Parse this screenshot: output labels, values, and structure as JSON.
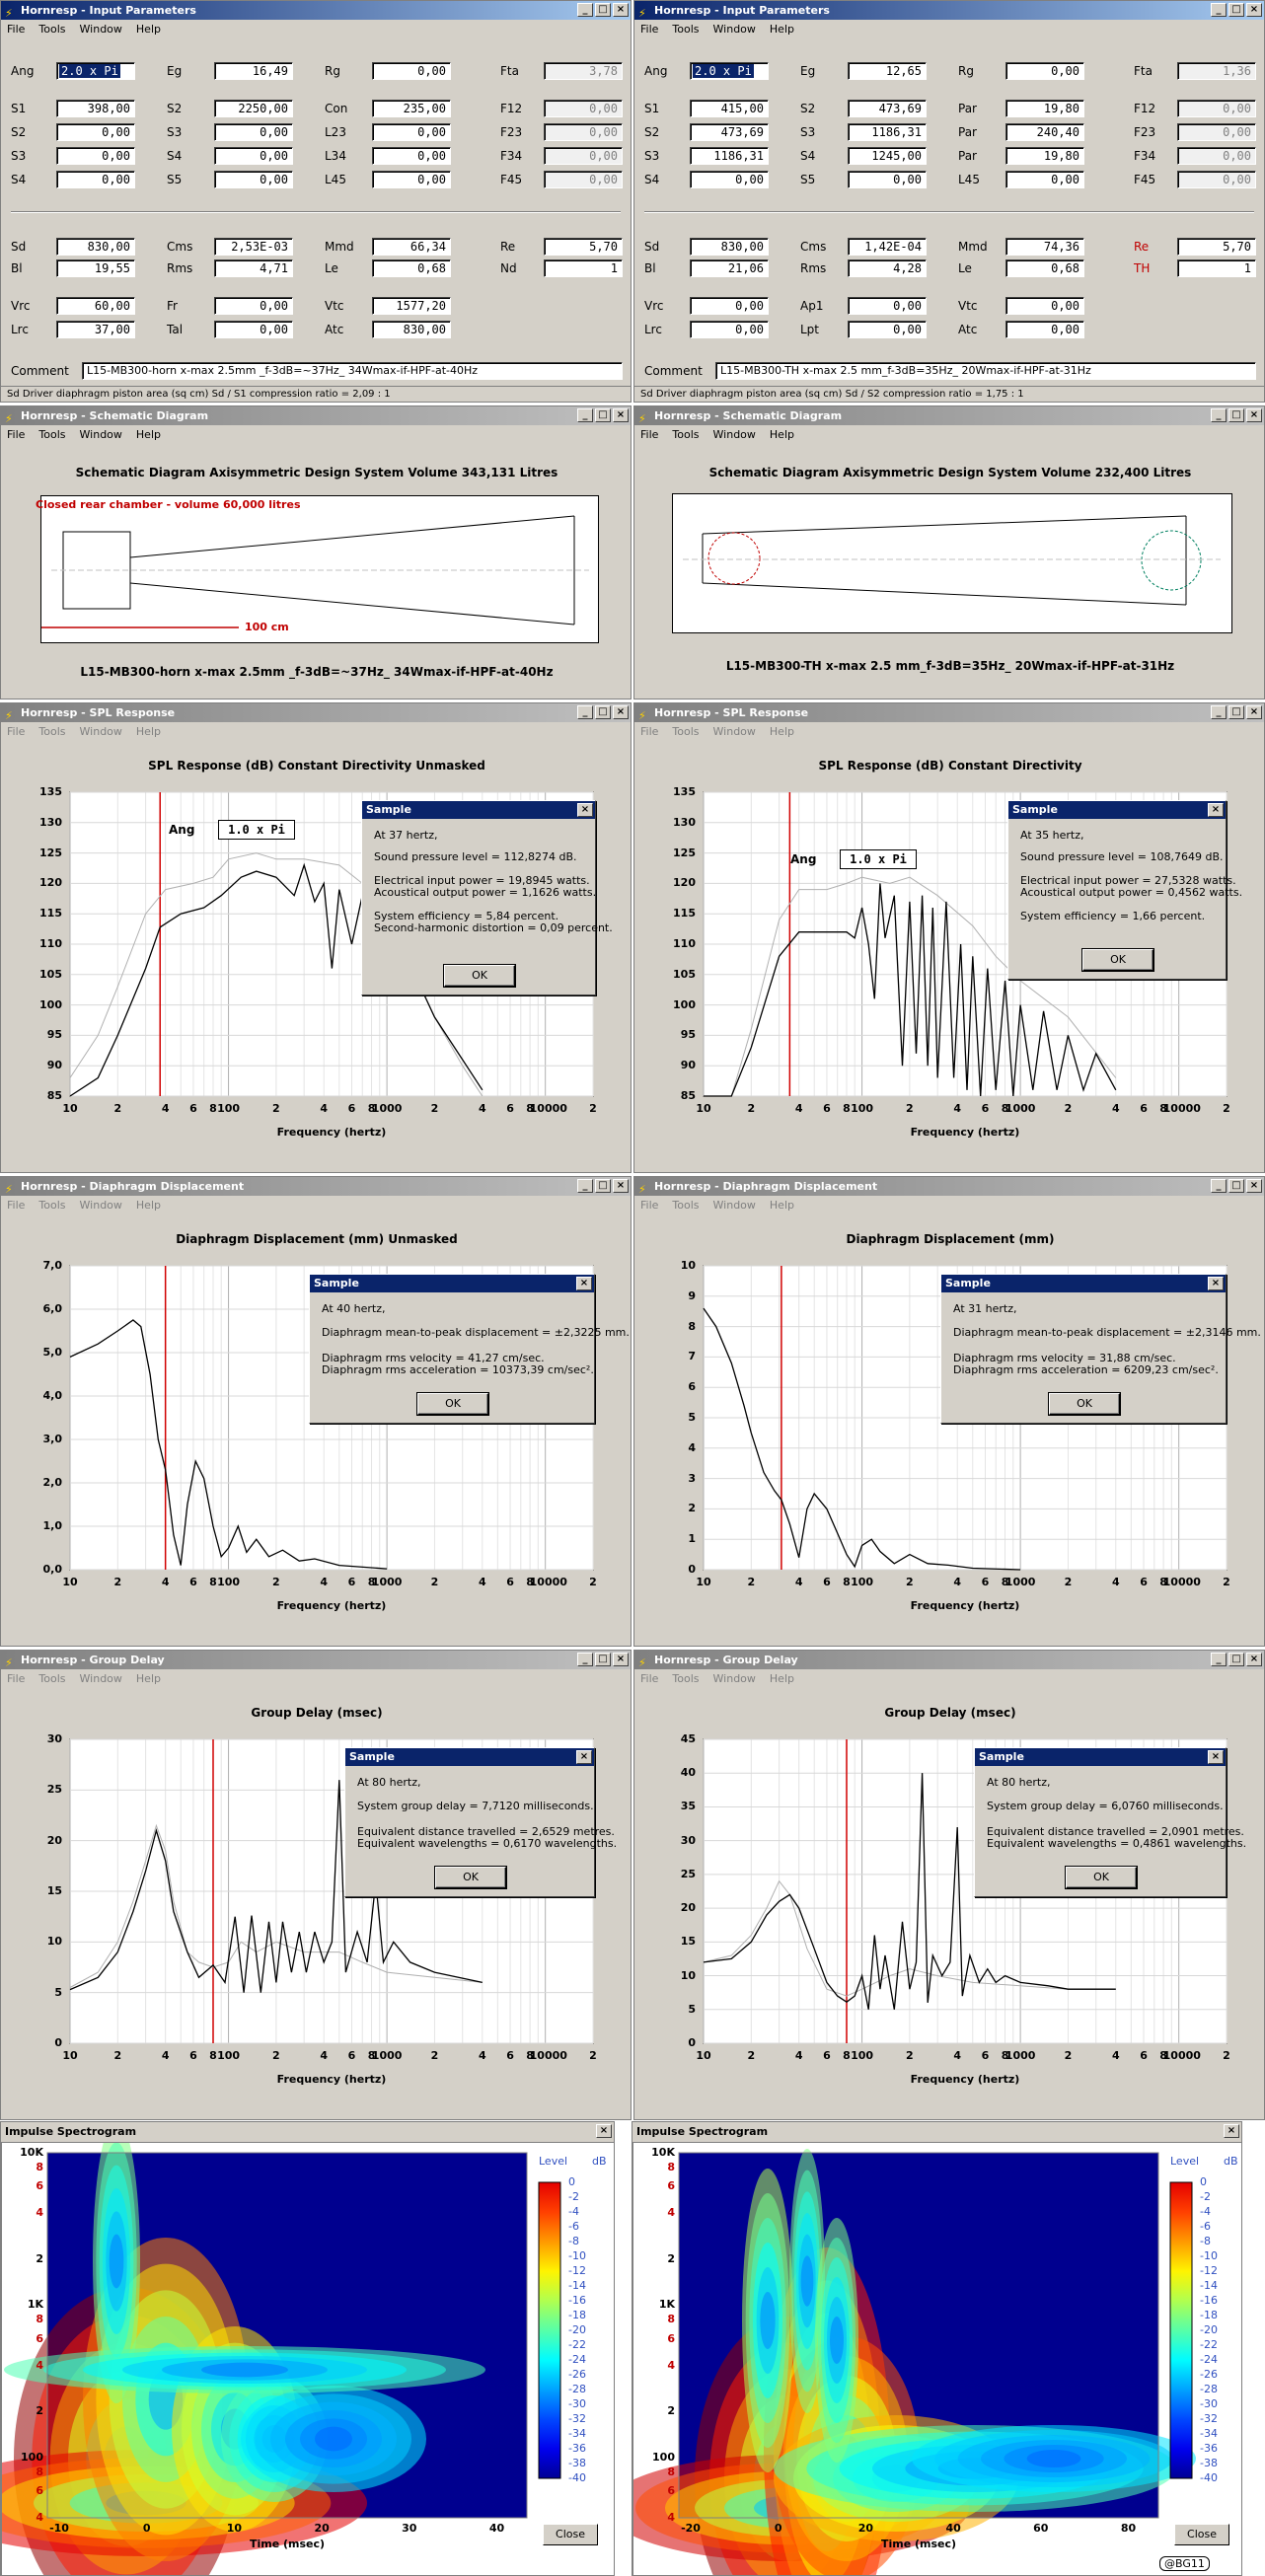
{
  "menus_active": [
    "File",
    "Tools",
    "Window",
    "Help"
  ],
  "menus_inactive": [
    "File",
    "Tools",
    "Window",
    "Help"
  ],
  "input_left": {
    "title": "Hornresp - Input Parameters",
    "rows": [
      [
        {
          "l": "Ang",
          "v": "2.0 x Pi",
          "sel": true
        },
        {
          "l": "Eg",
          "v": "16,49"
        },
        {
          "l": "Rg",
          "v": "0,00"
        },
        {
          "l": "Fta",
          "v": "3,78",
          "dis": true
        }
      ],
      [
        {
          "l": "S1",
          "v": "398,00"
        },
        {
          "l": "S2",
          "v": "2250,00"
        },
        {
          "l": "Con",
          "v": "235,00"
        },
        {
          "l": "F12",
          "v": "0,00",
          "dis": true
        }
      ],
      [
        {
          "l": "S2",
          "v": "0,00"
        },
        {
          "l": "S3",
          "v": "0,00"
        },
        {
          "l": "L23",
          "v": "0,00"
        },
        {
          "l": "F23",
          "v": "0,00",
          "dis": true
        }
      ],
      [
        {
          "l": "S3",
          "v": "0,00"
        },
        {
          "l": "S4",
          "v": "0,00"
        },
        {
          "l": "L34",
          "v": "0,00"
        },
        {
          "l": "F34",
          "v": "0,00",
          "dis": true
        }
      ],
      [
        {
          "l": "S4",
          "v": "0,00"
        },
        {
          "l": "S5",
          "v": "0,00"
        },
        {
          "l": "L45",
          "v": "0,00"
        },
        {
          "l": "F45",
          "v": "0,00",
          "dis": true
        }
      ]
    ],
    "rows2": [
      [
        {
          "l": "Sd",
          "v": "830,00"
        },
        {
          "l": "Cms",
          "v": "2,53E-03"
        },
        {
          "l": "Mmd",
          "v": "66,34"
        },
        {
          "l": "Re",
          "v": "5,70"
        }
      ],
      [
        {
          "l": "Bl",
          "v": "19,55"
        },
        {
          "l": "Rms",
          "v": "4,71"
        },
        {
          "l": "Le",
          "v": "0,68"
        },
        {
          "l": "Nd",
          "v": "1"
        }
      ]
    ],
    "rows3": [
      [
        {
          "l": "Vrc",
          "v": "60,00"
        },
        {
          "l": "Fr",
          "v": "0,00"
        },
        {
          "l": "Vtc",
          "v": "1577,20"
        }
      ],
      [
        {
          "l": "Lrc",
          "v": "37,00"
        },
        {
          "l": "Tal",
          "v": "0,00"
        },
        {
          "l": "Atc",
          "v": "830,00"
        }
      ]
    ],
    "comment_label": "Comment",
    "comment": "L15-MB300-horn x-max 2.5mm _f-3dB=~37Hz_ 34Wmax-if-HPF-at-40Hz",
    "status": "Sd   Driver diaphragm piston area  (sq cm)   Sd / S1 compression ratio = 2,09 : 1"
  },
  "input_right": {
    "title": "Hornresp - Input Parameters",
    "rows": [
      [
        {
          "l": "Ang",
          "v": "2.0 x Pi",
          "sel": true
        },
        {
          "l": "Eg",
          "v": "12,65"
        },
        {
          "l": "Rg",
          "v": "0,00"
        },
        {
          "l": "Fta",
          "v": "1,36",
          "dis": true
        }
      ],
      [
        {
          "l": "S1",
          "v": "415,00"
        },
        {
          "l": "S2",
          "v": "473,69"
        },
        {
          "l": "Par",
          "v": "19,80"
        },
        {
          "l": "F12",
          "v": "0,00",
          "dis": true
        }
      ],
      [
        {
          "l": "S2",
          "v": "473,69"
        },
        {
          "l": "S3",
          "v": "1186,31"
        },
        {
          "l": "Par",
          "v": "240,40"
        },
        {
          "l": "F23",
          "v": "0,00",
          "dis": true
        }
      ],
      [
        {
          "l": "S3",
          "v": "1186,31"
        },
        {
          "l": "S4",
          "v": "1245,00"
        },
        {
          "l": "Par",
          "v": "19,80"
        },
        {
          "l": "F34",
          "v": "0,00",
          "dis": true
        }
      ],
      [
        {
          "l": "S4",
          "v": "0,00"
        },
        {
          "l": "S5",
          "v": "0,00"
        },
        {
          "l": "L45",
          "v": "0,00"
        },
        {
          "l": "F45",
          "v": "0,00",
          "dis": true
        }
      ]
    ],
    "rows2": [
      [
        {
          "l": "Sd",
          "v": "830,00"
        },
        {
          "l": "Cms",
          "v": "1,42E-04"
        },
        {
          "l": "Mmd",
          "v": "74,36"
        },
        {
          "l": "Re",
          "v": "5,70",
          "red": true
        }
      ],
      [
        {
          "l": "Bl",
          "v": "21,06"
        },
        {
          "l": "Rms",
          "v": "4,28"
        },
        {
          "l": "Le",
          "v": "0,68"
        },
        {
          "l": "TH",
          "v": "1",
          "red": true
        }
      ]
    ],
    "rows3": [
      [
        {
          "l": "Vrc",
          "v": "0,00"
        },
        {
          "l": "Ap1",
          "v": "0,00"
        },
        {
          "l": "Vtc",
          "v": "0,00"
        }
      ],
      [
        {
          "l": "Lrc",
          "v": "0,00"
        },
        {
          "l": "Lpt",
          "v": "0,00"
        },
        {
          "l": "Atc",
          "v": "0,00"
        }
      ]
    ],
    "comment_label": "Comment",
    "comment": "L15-MB300-TH x-max 2.5 mm_f-3dB=35Hz_ 20Wmax-if-HPF-at-31Hz",
    "status": "Sd   Driver diaphragm piston area  (sq cm)   Sd / S2 compression ratio = 1,75 : 1"
  },
  "schem_left": {
    "title": "Hornresp - Schematic Diagram",
    "header": "Schematic Diagram    Axisymmetric Design    System Volume 343,131 Litres",
    "chamber_label": "Closed rear chamber - volume 60,000 litres",
    "scale_label": "100 cm",
    "caption": "L15-MB300-horn x-max 2.5mm _f-3dB=~37Hz_ 34Wmax-if-HPF-at-40Hz"
  },
  "schem_right": {
    "title": "Hornresp - Schematic Diagram",
    "header": "Schematic Diagram    Axisymmetric Design    System Volume 232,400 Litres",
    "caption": "L15-MB300-TH x-max 2.5 mm_f-3dB=35Hz_ 20Wmax-if-HPF-at-31Hz"
  },
  "freq_ticks": [
    "10",
    "2",
    "4",
    "6",
    "8",
    "100",
    "2",
    "4",
    "6",
    "8",
    "1000",
    "2",
    "4",
    "6",
    "8",
    "10000",
    "2"
  ],
  "spl_left": {
    "title": "Hornresp - SPL Response",
    "header": "SPL Response (dB)    Constant Directivity    Unmasked",
    "xlabel": "Frequency (hertz)",
    "yticks": [
      "135",
      "130",
      "125",
      "120",
      "115",
      "110",
      "105",
      "100",
      "95",
      "90",
      "85"
    ],
    "ang_label": "Ang",
    "ang_value": "1.0 x Pi",
    "dialog": {
      "title": "Sample",
      "lines": [
        "At 37 hertz,",
        "Sound pressure level = 112,8274 dB.",
        "Electrical input power = 19,8945 watts.",
        "Acoustical output power = 1,1626 watts.",
        "System efficiency = 5,84 percent.",
        "Second-harmonic distortion = 0,09 percent."
      ],
      "ok": "OK"
    }
  },
  "spl_right": {
    "title": "Hornresp - SPL Response",
    "header": "SPL Response (dB)    Constant Directivity",
    "xlabel": "Frequency (hertz)",
    "yticks": [
      "135",
      "130",
      "125",
      "120",
      "115",
      "110",
      "105",
      "100",
      "95",
      "90",
      "85"
    ],
    "ang_label": "Ang",
    "ang_value": "1.0 x Pi",
    "dialog": {
      "title": "Sample",
      "lines": [
        "At 35 hertz,",
        "Sound pressure level = 108,7649 dB.",
        "Electrical input power = 27,5328 watts.",
        "Acoustical output power = 0,4562 watts.",
        "System efficiency = 1,66 percent."
      ],
      "ok": "OK"
    }
  },
  "disp_left": {
    "title": "Hornresp - Diaphragm Displacement",
    "header": "Diaphragm Displacement (mm)    Unmasked",
    "xlabel": "Frequency (hertz)",
    "yticks": [
      "7,0",
      "6,0",
      "5,0",
      "4,0",
      "3,0",
      "2,0",
      "1,0",
      "0,0"
    ],
    "dialog": {
      "title": "Sample",
      "lines": [
        "At 40 hertz,",
        "Diaphragm mean-to-peak displacement = ±2,3225 mm.",
        "Diaphragm rms velocity = 41,27 cm/sec.",
        "Diaphragm rms acceleration = 10373,39 cm/sec².",
        "",
        ""
      ],
      "ok": "OK"
    }
  },
  "disp_right": {
    "title": "Hornresp - Diaphragm Displacement",
    "header": "Diaphragm Displacement (mm)",
    "xlabel": "Frequency (hertz)",
    "yticks": [
      "10",
      "9",
      "8",
      "7",
      "6",
      "5",
      "4",
      "3",
      "2",
      "1",
      "0"
    ],
    "dialog": {
      "title": "Sample",
      "lines": [
        "At 31 hertz,",
        "Diaphragm mean-to-peak displacement = ±2,3146 mm.",
        "Diaphragm rms velocity = 31,88 cm/sec.",
        "Diaphragm rms acceleration = 6209,23 cm/sec².",
        "",
        ""
      ],
      "ok": "OK"
    }
  },
  "gd_left": {
    "title": "Hornresp - Group Delay",
    "header": "Group Delay (msec)",
    "xlabel": "Frequency (hertz)",
    "yticks": [
      "30",
      "25",
      "20",
      "15",
      "10",
      "5",
      "0"
    ],
    "dialog": {
      "title": "Sample",
      "lines": [
        "At 80 hertz,",
        "System group delay = 7,7120 milliseconds.",
        "Equivalent distance travelled = 2,6529 metres.",
        "Equivalent wavelengths = 0,6170 wavelengths.",
        "",
        ""
      ],
      "ok": "OK"
    }
  },
  "gd_right": {
    "title": "Hornresp - Group Delay",
    "header": "Group Delay (msec)",
    "xlabel": "Frequency (hertz)",
    "yticks": [
      "45",
      "40",
      "35",
      "30",
      "25",
      "20",
      "15",
      "10",
      "5",
      "0"
    ],
    "dialog": {
      "title": "Sample",
      "lines": [
        "At 80 hertz,",
        "System group delay = 6,0760 milliseconds.",
        "Equivalent distance travelled = 2,0901 metres.",
        "Equivalent wavelengths = 0,4861 wavelengths.",
        "",
        ""
      ],
      "ok": "OK"
    }
  },
  "spec_left": {
    "title": "Impulse Spectrogram",
    "yticks": [
      "10K",
      "8",
      "6",
      "4",
      "2",
      "1K",
      "8",
      "6",
      "4",
      "2",
      "100",
      "8",
      "6",
      "4"
    ],
    "xticks": [
      "-10",
      "0",
      "10",
      "20",
      "30",
      "40"
    ],
    "xlabel": "Time (msec)",
    "level_label": "Level",
    "db_label": "dB",
    "levels": [
      "0",
      "-2",
      "-4",
      "-6",
      "-8",
      "-10",
      "-12",
      "-14",
      "-16",
      "-18",
      "-20",
      "-22",
      "-24",
      "-26",
      "-28",
      "-30",
      "-32",
      "-34",
      "-36",
      "-38",
      "-40"
    ],
    "close": "Close"
  },
  "spec_right": {
    "title": "Impulse Spectrogram",
    "yticks": [
      "10K",
      "8",
      "6",
      "4",
      "2",
      "1K",
      "8",
      "6",
      "4",
      "2",
      "100",
      "8",
      "6",
      "4"
    ],
    "xticks": [
      "-20",
      "0",
      "20",
      "40",
      "60",
      "80"
    ],
    "xlabel": "Time (msec)",
    "level_label": "Level",
    "db_label": "dB",
    "levels": [
      "0",
      "-2",
      "-4",
      "-6",
      "-8",
      "-10",
      "-12",
      "-14",
      "-16",
      "-18",
      "-20",
      "-22",
      "-24",
      "-26",
      "-28",
      "-30",
      "-32",
      "-34",
      "-36",
      "-38",
      "-40"
    ],
    "close": "Close",
    "watermark": "@BG11"
  },
  "chart_data": [
    {
      "type": "line",
      "title": "SPL Response (dB)",
      "xlabel": "Frequency (hertz)",
      "x": [
        10,
        20,
        30,
        37,
        50,
        100,
        200,
        300,
        400,
        500,
        1000,
        2000,
        4000
      ],
      "series": [
        {
          "values": [
            85,
            95,
            108,
            112.8,
            117,
            122,
            121,
            117,
            115,
            112,
            100,
            90,
            85
          ]
        }
      ],
      "ylim": [
        85,
        135
      ],
      "xscale": "log"
    },
    {
      "type": "line",
      "title": "SPL Response (dB)",
      "xlabel": "Frequency (hertz)",
      "x": [
        10,
        20,
        35,
        50,
        100,
        150,
        200,
        500,
        1000,
        2000,
        4000
      ],
      "series": [
        {
          "values": [
            72,
            90,
            108.8,
            112,
            112,
            120,
            117,
            105,
            100,
            92,
            85
          ]
        }
      ],
      "ylim": [
        85,
        135
      ],
      "xscale": "log"
    },
    {
      "type": "line",
      "title": "Diaphragm Displacement (mm)",
      "xlabel": "Frequency (hertz)",
      "x": [
        10,
        20,
        30,
        35,
        40,
        50,
        60,
        70,
        100,
        150,
        200,
        500
      ],
      "series": [
        {
          "values": [
            4.9,
            5.3,
            5.7,
            4.5,
            2.32,
            0.5,
            2.5,
            1.2,
            0.6,
            0.3,
            0.2,
            0
          ]
        }
      ],
      "ylim": [
        0,
        7
      ],
      "xscale": "log"
    },
    {
      "type": "line",
      "title": "Diaphragm Displacement (mm)",
      "xlabel": "Frequency (hertz)",
      "x": [
        10,
        15,
        20,
        25,
        31,
        40,
        50,
        70,
        100,
        200,
        500
      ],
      "series": [
        {
          "values": [
            8.6,
            6.5,
            4.5,
            3,
            2.31,
            1,
            2.5,
            1.3,
            0.8,
            0.3,
            0
          ]
        }
      ],
      "ylim": [
        0,
        10
      ],
      "xscale": "log"
    },
    {
      "type": "line",
      "title": "Group Delay (msec)",
      "xlabel": "Frequency (hertz)",
      "x": [
        10,
        20,
        30,
        35,
        50,
        80,
        100,
        200,
        500,
        1000,
        2000,
        4000
      ],
      "series": [
        {
          "values": [
            5.5,
            9,
            17,
            21,
            10,
            7.7,
            10,
            9,
            8,
            6.5,
            6,
            6
          ]
        }
      ],
      "ylim": [
        0,
        30
      ],
      "xscale": "log"
    },
    {
      "type": "line",
      "title": "Group Delay (msec)",
      "xlabel": "Frequency (hertz)",
      "x": [
        10,
        20,
        30,
        35,
        50,
        80,
        100,
        200,
        300,
        500,
        1000,
        4000
      ],
      "series": [
        {
          "values": [
            12,
            15,
            20,
            22,
            12,
            6.1,
            8,
            15,
            40,
            12,
            9,
            8
          ]
        }
      ],
      "ylim": [
        0,
        45
      ],
      "xscale": "log"
    }
  ]
}
